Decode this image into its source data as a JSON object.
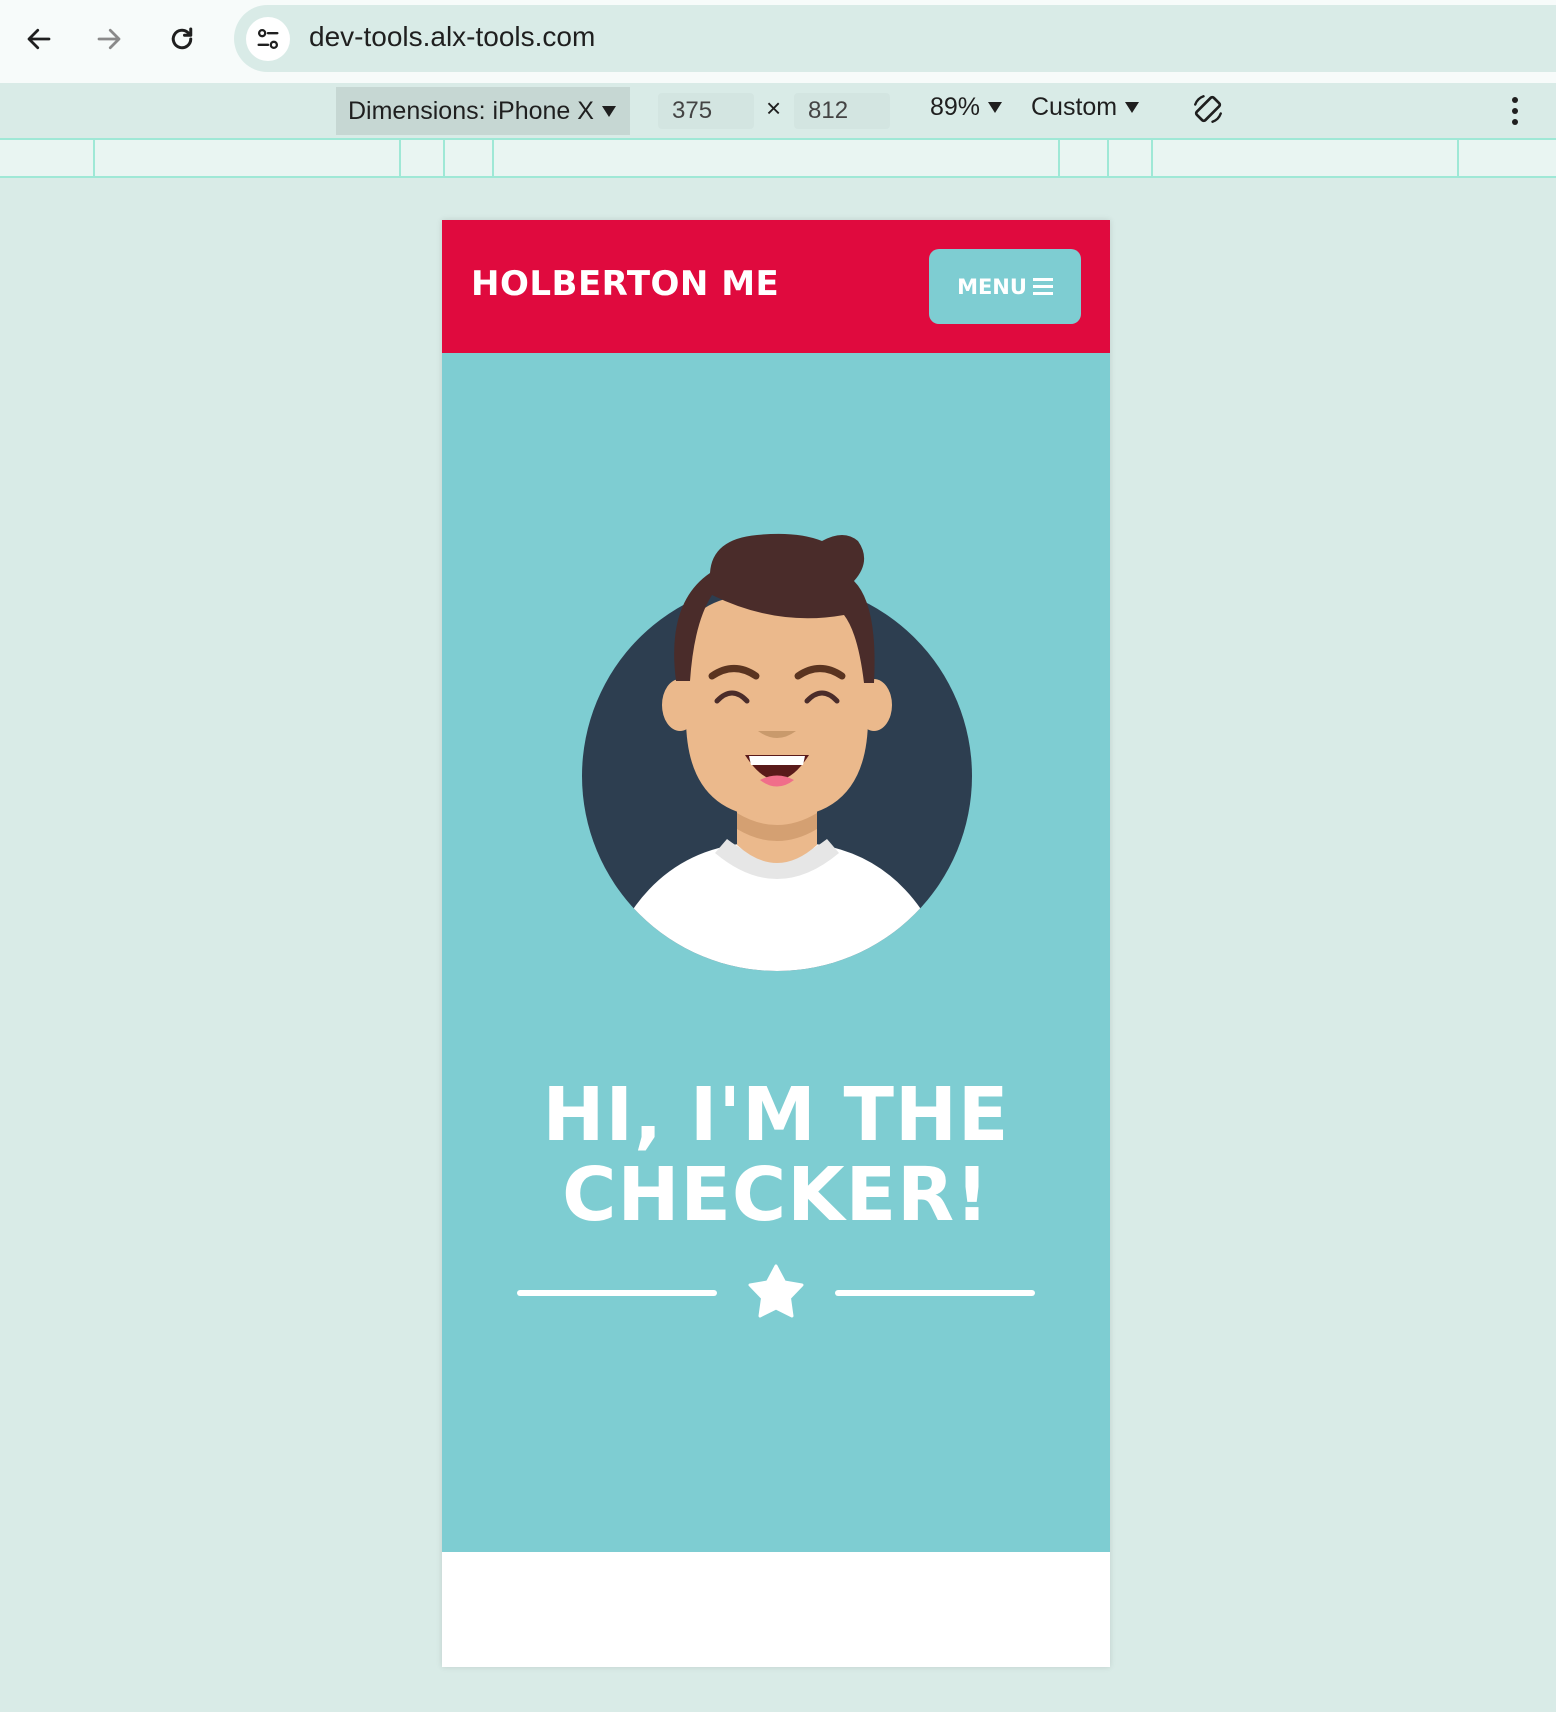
{
  "browser": {
    "url": "dev-tools.alx-tools.com",
    "icons": {
      "back": "arrow-left-icon",
      "forward": "arrow-right-icon",
      "reload": "reload-icon",
      "site_info": "tune-icon"
    }
  },
  "devtools": {
    "dimensions_label": "Dimensions: iPhone X",
    "width": "375",
    "height": "812",
    "times": "×",
    "zoom": "89%",
    "throttle": "Custom",
    "rotate_icon": "rotate-icon",
    "more_icon": "kebab-menu-icon"
  },
  "page": {
    "logo": "HOLBERTON ME",
    "menu_label": "MENU",
    "hero_title_line1": "HI, I'M THE",
    "hero_title_line2": "CHECKER!",
    "divider_icon": "star-icon",
    "colors": {
      "header": "#e00a3e",
      "hero": "#7ecdd2",
      "avatar_bg": "#2d3e50",
      "white": "#ffffff"
    }
  }
}
